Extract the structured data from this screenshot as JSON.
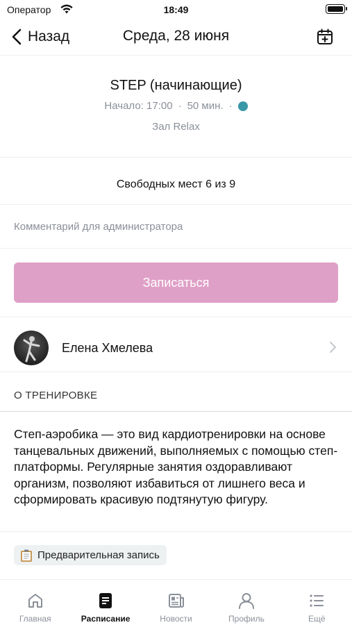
{
  "status_bar": {
    "carrier": "Оператор",
    "time": "18:49"
  },
  "nav": {
    "back_label": "Назад",
    "title": "Среда, 28 июня",
    "calendar_icon": "calendar-plus-icon"
  },
  "class_info": {
    "title": "STEP (начинающие)",
    "start": "Начало: 17:00",
    "separator": "·",
    "duration": "50 мин.",
    "status_color": "#3a97a8",
    "hall": "Зал Relax"
  },
  "free_places": "Свободных мест 6 из 9",
  "comment": {
    "placeholder": "Комментарий для администратора",
    "value": ""
  },
  "signup": {
    "label": "Записаться",
    "color": "#dfa0c7"
  },
  "trainer": {
    "name": "Елена Хмелева"
  },
  "about": {
    "header": "О ТРЕНИРОВКЕ",
    "description": "Степ-аэробика — это вид кардиотренировки на основе танцевальных движений, выполняемых с помощью степ-платформы. Регулярные занятия оздоравливают организм, позволяют избавиться от лишнего веса и сформировать красивую подтянутую фигуру."
  },
  "badge": {
    "icon": "clipboard-icon",
    "label": "Предварительная запись"
  },
  "tabs": [
    {
      "label": "Главная",
      "icon": "home-icon",
      "active": false
    },
    {
      "label": "Расписание",
      "icon": "schedule-icon",
      "active": true
    },
    {
      "label": "Новости",
      "icon": "news-icon",
      "active": false
    },
    {
      "label": "Профиль",
      "icon": "profile-icon",
      "active": false
    },
    {
      "label": "Ещё",
      "icon": "more-icon",
      "active": false
    }
  ]
}
